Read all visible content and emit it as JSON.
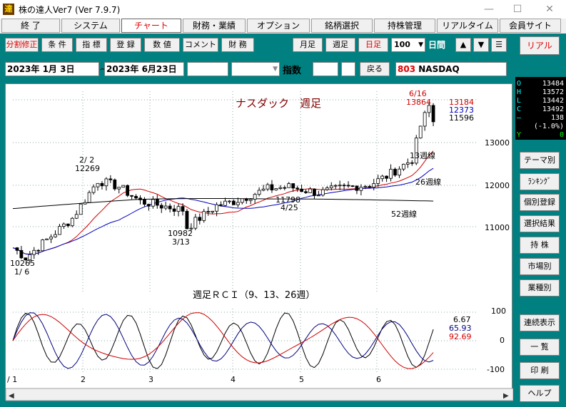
{
  "window": {
    "title": "株の達人Ver7 (Ver 7.9.7)",
    "app_icon": "達",
    "minimize": "—",
    "maximize": "☐",
    "close": "✕"
  },
  "menu": [
    "終 了",
    "システム",
    "チャート",
    "財務・業績",
    "オプション",
    "銘柄選択",
    "持株管理",
    "リアルタイム",
    "会員サイト"
  ],
  "toolbar": {
    "left": [
      "分割修正",
      "条 件",
      "指 標",
      "登 録",
      "数 値",
      "コメント",
      "財 務"
    ],
    "right": [
      "月足",
      "週足",
      "日足"
    ],
    "count": "100",
    "period_label": "日間",
    "real": "リアル"
  },
  "range": {
    "start": "2023年 1月 3日",
    "tilde": "～",
    "end": "2023年 6月23日",
    "index_label": "指数",
    "back": "戻る",
    "code": "803",
    "name": "NASDAQ"
  },
  "quote": {
    "O": "13484",
    "H": "13572",
    "L": "13442",
    "C": "13492",
    "change": "138",
    "pct": "(-1.0%)",
    "Y": "0"
  },
  "side_buttons": [
    "テーマ別",
    "ﾗﾝｷﾝｸﾞ",
    "個別登録",
    "選択結果",
    "持 株",
    "市場別",
    "業種別",
    "連続表示",
    "一 覧",
    "印 刷",
    "ヘルプ"
  ],
  "chart_data": [
    {
      "type": "candlestick",
      "title": "ナスダック　週足",
      "ylim": [
        10000,
        14000
      ],
      "yticks": [
        "13000",
        "12000",
        "11000"
      ],
      "xticks": [
        "/ 1",
        "2",
        "3",
        "4",
        "5",
        "6"
      ],
      "legend_values": {
        "13週": "13184",
        "26週": "12373",
        "52週": "11596"
      },
      "series": [
        {
          "name": "13週線",
          "color": "#d00000"
        },
        {
          "name": "26週線",
          "color": "#0000c0"
        },
        {
          "name": "52週線",
          "color": "#000000"
        }
      ],
      "annotations": [
        {
          "label": "6/16",
          "value": "13864"
        },
        {
          "label": "2/ 2",
          "value": "12269"
        },
        {
          "label": "10982",
          "value": "3/13"
        },
        {
          "label": "11798",
          "value": "4/25"
        },
        {
          "label": "10265",
          "value": "1/ 6"
        }
      ]
    },
    {
      "type": "line",
      "title": "週足ＲＣＩ（9、13、26週）",
      "ylim": [
        -100,
        100
      ],
      "yticks": [
        "100",
        "0",
        "-100"
      ],
      "legend_values": [
        "6.67",
        "65.93",
        "92.69"
      ],
      "series": [
        {
          "name": "9週",
          "color": "#000000"
        },
        {
          "name": "13週",
          "color": "#000080"
        },
        {
          "name": "26週",
          "color": "#d00000"
        }
      ]
    }
  ]
}
